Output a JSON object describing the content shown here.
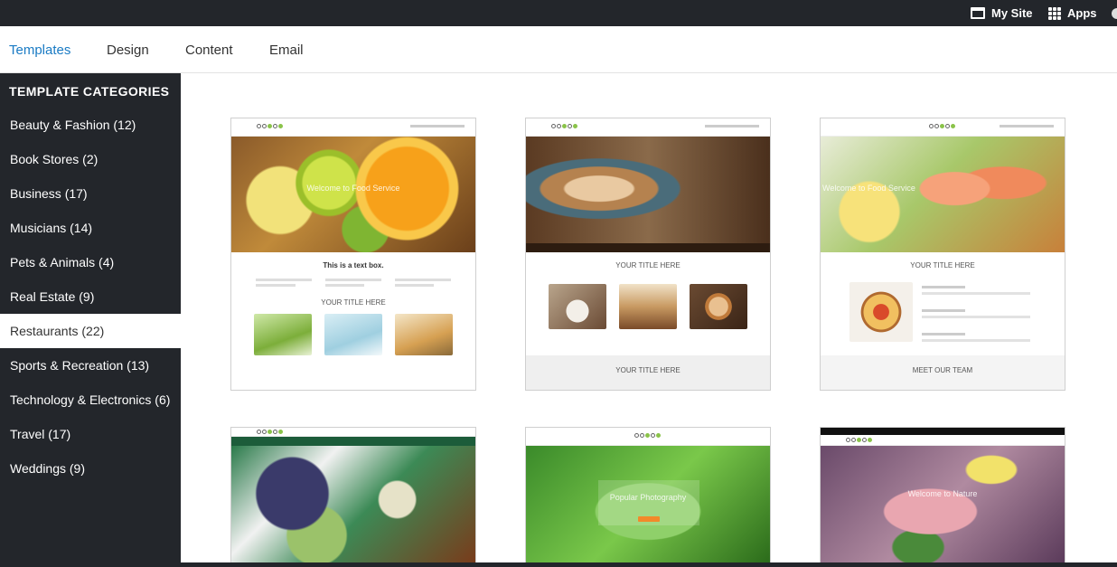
{
  "topbar": {
    "my_site_label": "My Site",
    "my_site_icon": "browser-window-icon",
    "apps_label": "Apps",
    "apps_icon": "grid-icon"
  },
  "tabs": [
    {
      "label": "Templates",
      "active": true
    },
    {
      "label": "Design",
      "active": false
    },
    {
      "label": "Content",
      "active": false
    },
    {
      "label": "Email",
      "active": false
    }
  ],
  "sidebar": {
    "heading": "TEMPLATE CATEGORIES",
    "categories": [
      {
        "label": "Beauty & Fashion (12)"
      },
      {
        "label": "Book Stores (2)"
      },
      {
        "label": "Business (17)"
      },
      {
        "label": "Musicians (14)"
      },
      {
        "label": "Pets & Animals (4)"
      },
      {
        "label": "Real Estate (9)"
      },
      {
        "label": "Restaurants (22)",
        "selected": true
      },
      {
        "label": "Sports & Recreation (13)"
      },
      {
        "label": "Technology & Electronics (6)"
      },
      {
        "label": "Travel (17)"
      },
      {
        "label": "Weddings (9)"
      }
    ]
  },
  "templates": [
    {
      "hero_text": "Welcome to Food Service",
      "section_title": "YOUR TITLE HERE",
      "box_title": "This is a text box."
    },
    {
      "section_title": "YOUR TITLE HERE",
      "band_title": "YOUR TITLE HERE"
    },
    {
      "hero_text": "Welcome to Food Service",
      "section_title": "YOUR TITLE HERE",
      "band_title": "MEET OUR TEAM"
    },
    {},
    {
      "hero_text": "Popular Photography"
    },
    {
      "hero_text": "Welcome to Nature"
    }
  ],
  "colors": {
    "dark": "#23262b",
    "accent": "#1a7bc4"
  }
}
